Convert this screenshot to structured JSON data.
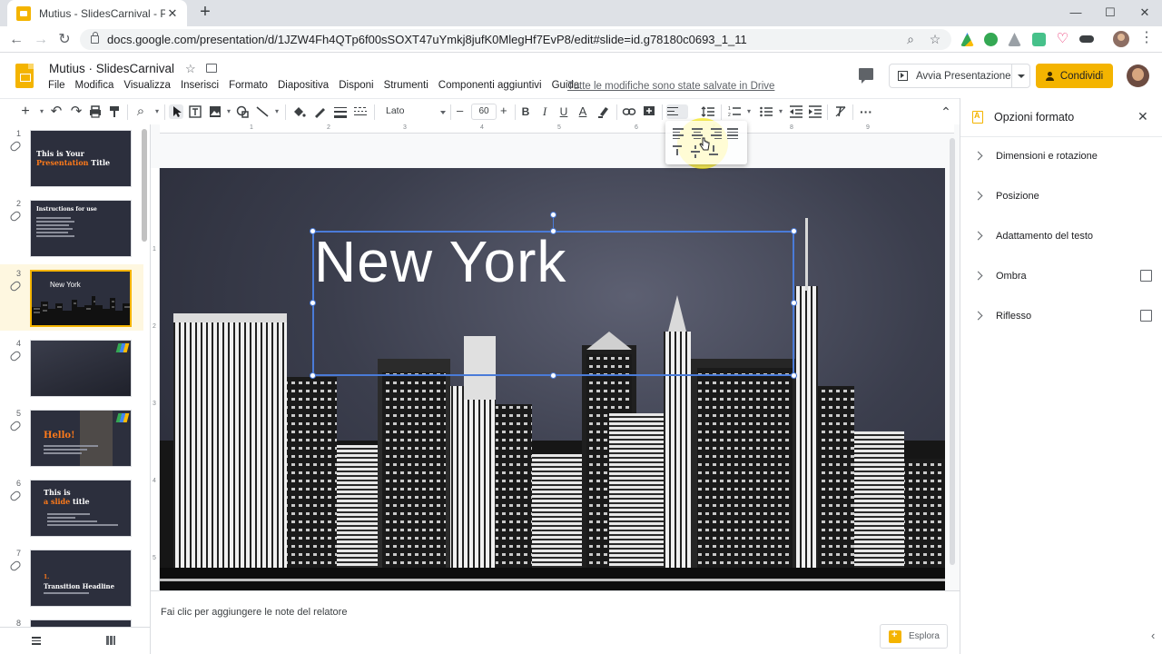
{
  "browser": {
    "tab_title": "Mutius - SlidesCarnival - Presentazi",
    "tab_close": "✕",
    "new_tab": "+",
    "window_controls": [
      "—",
      "☐",
      "✕"
    ],
    "back": "←",
    "forward": "→",
    "reload": "↻",
    "url": "docs.google.com/presentation/d/1JZW4Fh4QTp6f00sSOXT47uYmkj8jufK0MlegHf7EvP8/edit#slide=id.g78180c0693_1_11",
    "zoom_icon": "⌕",
    "bookmark_icon": "☆",
    "menu_icon": "⋮"
  },
  "header": {
    "doc_title": "Mutius · SlidesCarnival",
    "star": "☆",
    "menu": [
      "File",
      "Modifica",
      "Visualizza",
      "Inserisci",
      "Formato",
      "Diapositiva",
      "Disponi",
      "Strumenti",
      "Componenti aggiuntivi",
      "Guida"
    ],
    "saved_status": "Tutte le modifiche sono state salvate in Drive",
    "present_label": "Avvia Presentazione",
    "share_label": "Condividi"
  },
  "toolbar": {
    "new": "+",
    "undo": "↶",
    "redo": "↷",
    "zoom": "⌕",
    "font": "Lato",
    "size_minus": "–",
    "font_size": "60",
    "size_plus": "+",
    "bold": "B",
    "italic": "I",
    "underline": "U",
    "text_color": "A",
    "more": "···",
    "collapse": "⌃"
  },
  "filmstrip": {
    "slides": [
      {
        "num": "1",
        "title_line1": "This is Your",
        "title_line2_accent": "Presentation",
        "title_line2_rest": " Title"
      },
      {
        "num": "2",
        "small_title": "Instructions for use"
      },
      {
        "num": "3",
        "label": "New York"
      },
      {
        "num": "4"
      },
      {
        "num": "5",
        "hello": "Hello!"
      },
      {
        "num": "6",
        "title_line1": "This is",
        "title_line2_accent": "a slide",
        "title_line2_rest": " title"
      },
      {
        "num": "7",
        "small_title": "1.",
        "title_line2_rest": "Transition Headline"
      },
      {
        "num": "8"
      }
    ]
  },
  "canvas": {
    "ruler_h": [
      "1",
      "2",
      "3",
      "4",
      "5",
      "6",
      "7",
      "8",
      "9"
    ],
    "ruler_v": [
      "1",
      "2",
      "3",
      "4",
      "5"
    ],
    "slide_title": "New York"
  },
  "notes": {
    "placeholder": "Fai clic per aggiungere le note del relatore",
    "explore_label": "Esplora"
  },
  "panel": {
    "title": "Opzioni formato",
    "close": "✕",
    "sections": [
      "Dimensioni e rotazione",
      "Posizione",
      "Adattamento del testo",
      "Ombra",
      "Riflesso"
    ],
    "collapse": "‹"
  },
  "colors": {
    "accent": "#f4b400",
    "selection": "#4a7bd8",
    "thumb_accent": "#ff7a1a"
  }
}
